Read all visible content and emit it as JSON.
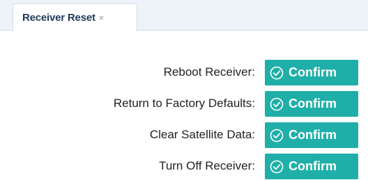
{
  "tabs": [
    {
      "label": "Receiver Reset",
      "close": "×"
    }
  ],
  "actions": [
    {
      "label": "Reboot Receiver:",
      "button": "Confirm"
    },
    {
      "label": "Return to Factory Defaults:",
      "button": "Confirm"
    },
    {
      "label": "Clear Satellite Data:",
      "button": "Confirm"
    },
    {
      "label": "Turn Off Receiver:",
      "button": "Confirm"
    }
  ],
  "colors": {
    "button_bg": "#1fafa8",
    "tabbar_bg": "#eef3f9"
  },
  "icons": {
    "button_icon": "check-circle-icon",
    "tab_close_icon": "close-icon"
  }
}
